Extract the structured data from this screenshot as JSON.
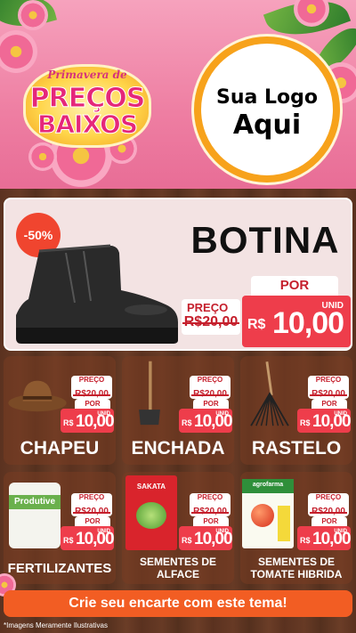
{
  "header": {
    "badge_top": "Primavera de",
    "badge_line1": "PREÇOS",
    "badge_line2": "BAIXOS",
    "logo_line1": "Sua Logo",
    "logo_line2": "Aqui"
  },
  "featured": {
    "discount": "-50%",
    "name": "BOTINA",
    "preco_label": "PREÇO",
    "old_price": "R$20,00",
    "por_label": "POR",
    "currency": "R$",
    "price": "10,00",
    "unit": "UNID"
  },
  "products": [
    {
      "name": "CHAPEU",
      "preco_label": "PREÇO",
      "old_price": "R$20,00",
      "por_label": "POR",
      "currency": "R$",
      "price": "10,00",
      "unit": "UNID"
    },
    {
      "name": "ENCHADA",
      "preco_label": "PREÇO",
      "old_price": "R$20,00",
      "por_label": "POR",
      "currency": "R$",
      "price": "10,00",
      "unit": "UNID"
    },
    {
      "name": "RASTELO",
      "preco_label": "PREÇO",
      "old_price": "R$20,00",
      "por_label": "POR",
      "currency": "R$",
      "price": "10,00",
      "unit": "UNID"
    },
    {
      "name": "FERTILIZANTES",
      "image_text": "Produtive",
      "preco_label": "PREÇO",
      "old_price": "R$20,00",
      "por_label": "POR",
      "currency": "R$",
      "price": "10,00",
      "unit": "UNID"
    },
    {
      "name_line1": "SEMENTES DE",
      "name_line2": "ALFACE",
      "image_text": "SAKATA",
      "preco_label": "PREÇO",
      "old_price": "R$20,00",
      "por_label": "POR",
      "currency": "R$",
      "price": "10,00",
      "unit": "UNID"
    },
    {
      "name_line1": "SEMENTES DE",
      "name_line2": "TOMATE HIBRIDA",
      "image_text": "agrofarma",
      "preco_label": "PREÇO",
      "old_price": "R$20,00",
      "por_label": "POR",
      "currency": "R$",
      "price": "10,00",
      "unit": "UNID"
    }
  ],
  "footer": {
    "cta": "Crie seu encarte com este tema!",
    "disclaimer": "*Imagens Meramente Ilustrativas"
  },
  "colors": {
    "header_pink": "#ee7ea2",
    "price_red": "#ee3d4b",
    "cta_orange": "#f25d23",
    "wood_brown": "#5b3220",
    "logo_ring": "#f7a21b"
  },
  "icons": [
    "boot-image",
    "hat-image",
    "hoe-image",
    "rake-image",
    "fertilizer-bag-image",
    "lettuce-seed-packet-image",
    "tomato-seed-packet-image",
    "flower-decoration"
  ]
}
